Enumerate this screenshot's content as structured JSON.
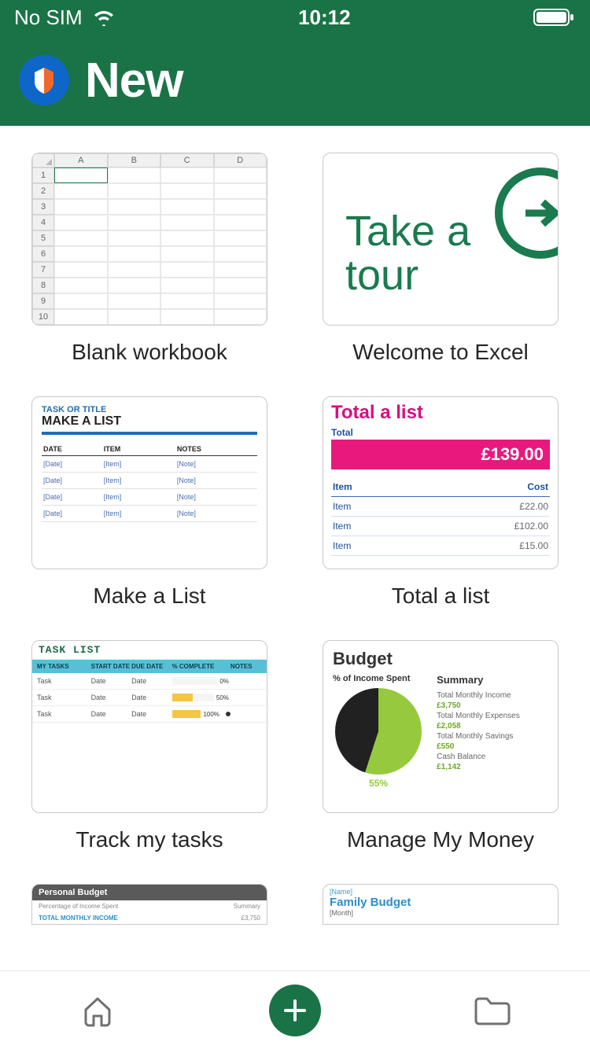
{
  "status": {
    "carrier": "No SIM",
    "time": "10:12"
  },
  "header": {
    "title": "New"
  },
  "templates": [
    {
      "label": "Blank workbook",
      "columns": [
        "A",
        "B",
        "C",
        "D"
      ],
      "rows": [
        "1",
        "2",
        "3",
        "4",
        "5",
        "6",
        "7",
        "8",
        "9",
        "10"
      ]
    },
    {
      "label": "Welcome to Excel",
      "text_line1": "Take a",
      "text_line2": "tour"
    },
    {
      "label": "Make a List",
      "subtitle": "TASK OR TITLE",
      "heading": "MAKE A LIST",
      "cols": [
        "DATE",
        "ITEM",
        "NOTES"
      ],
      "cells": {
        "date": "[Date]",
        "item": "[Item]",
        "notes": "[Note]"
      }
    },
    {
      "label": "Total a list",
      "heading": "Total a list",
      "total_label": "Total",
      "total_value": "£139.00",
      "head_item": "Item",
      "head_cost": "Cost",
      "rows": [
        {
          "item": "Item",
          "cost": "£22.00"
        },
        {
          "item": "Item",
          "cost": "£102.00"
        },
        {
          "item": "Item",
          "cost": "£15.00"
        }
      ]
    },
    {
      "label": "Track my tasks",
      "title": "TASK LIST",
      "headers": [
        "MY TASKS",
        "START DATE",
        "DUE DATE",
        "% COMPLETE",
        "NOTES"
      ],
      "rows": [
        {
          "task": "Task",
          "start": "Date",
          "due": "Date",
          "pct": 0,
          "pct_label": "0%"
        },
        {
          "task": "Task",
          "start": "Date",
          "due": "Date",
          "pct": 50,
          "pct_label": "50%"
        },
        {
          "task": "Task",
          "start": "Date",
          "due": "Date",
          "pct": 100,
          "pct_label": "100%"
        }
      ]
    },
    {
      "label": "Manage My Money",
      "heading": "Budget",
      "left_head": "% of Income Spent",
      "pie_pct": "55%",
      "right_head": "Summary",
      "summary": [
        {
          "k": "Total Monthly Income",
          "v": "£3,750"
        },
        {
          "k": "Total Monthly Expenses",
          "v": "£2,058"
        },
        {
          "k": "Total Monthly Savings",
          "v": "£550"
        },
        {
          "k": "Cash Balance",
          "v": "£1,142"
        }
      ]
    }
  ],
  "partial": [
    {
      "bar": "Personal Budget",
      "row": {
        "l": "Percentage of Income Spent",
        "r": "Summary"
      },
      "val_l": "TOTAL MONTHLY INCOME",
      "val_r": "£3,750"
    },
    {
      "name": "[Name]",
      "title": "Family Budget",
      "month": "[Month]"
    }
  ]
}
